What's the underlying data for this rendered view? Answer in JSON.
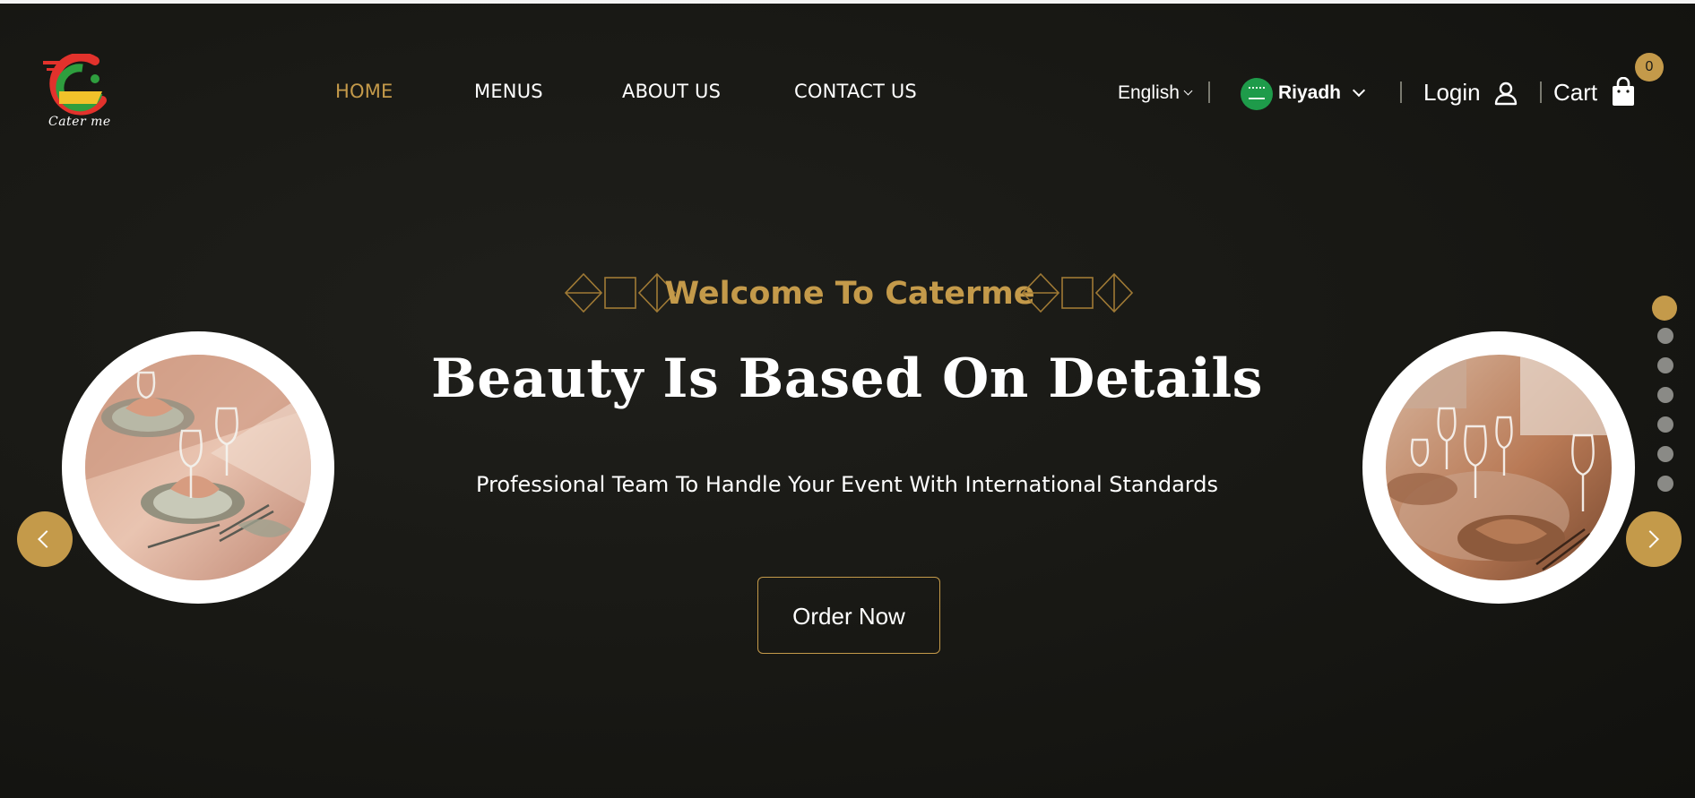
{
  "brand": {
    "logo_text": "Cater me"
  },
  "nav": {
    "items": [
      {
        "label": "HOME",
        "active": true
      },
      {
        "label": "MENUS",
        "active": false
      },
      {
        "label": "ABOUT US",
        "active": false
      },
      {
        "label": "CONTACT US",
        "active": false
      }
    ]
  },
  "header": {
    "language": "English",
    "city": "Riyadh",
    "login_label": "Login",
    "cart_label": "Cart",
    "cart_count": "0",
    "icons": [
      "chevron-down-icon",
      "saudi-flag-icon",
      "user-icon",
      "shopping-bag-icon"
    ]
  },
  "hero": {
    "welcome": "Welcome To Caterme",
    "headline": "Beauty Is Based On Details",
    "subheadline": "Professional Team To Handle Your Event With International Standards",
    "cta_label": "Order Now",
    "slides_total": 7,
    "active_slide": 1
  },
  "colors": {
    "accent": "#c49a4a",
    "background": "#191915",
    "text": "#ffffff",
    "dot_inactive": "#8a8a86"
  }
}
